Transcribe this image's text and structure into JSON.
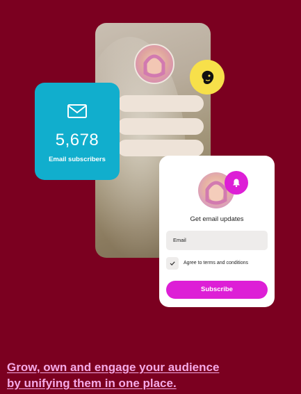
{
  "subscribers_card": {
    "count": "5,678",
    "label": "Email subscribers",
    "icon": "envelope-icon",
    "color": "#11aecd"
  },
  "signup_form": {
    "title": "Get email updates",
    "email_placeholder": "Email",
    "agree_label": "Agree to terms and conditions",
    "subscribe_label": "Subscribe",
    "accent": "#dd1fd6"
  },
  "integration_badge": {
    "icon": "mailchimp-icon",
    "color": "#f7e04a"
  },
  "headline": {
    "line1": "Grow, own and engage your audience",
    "line2": "by unifying them in one place."
  },
  "page": {
    "background": "#7b0020"
  }
}
